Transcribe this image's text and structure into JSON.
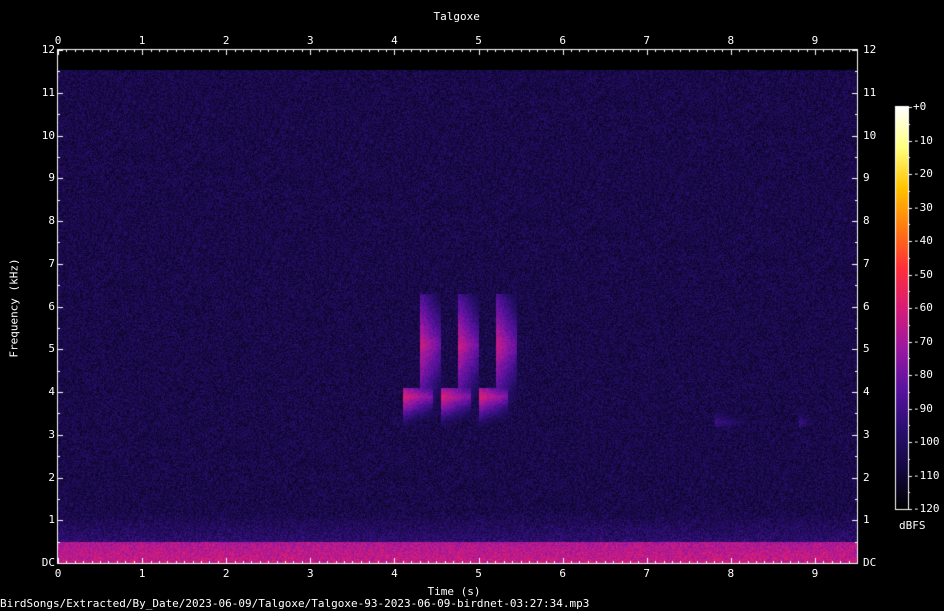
{
  "chart_data": {
    "type": "heatmap",
    "title": "Talgoxe",
    "xlabel": "Time (s)",
    "ylabel": "Frequency (kHz)",
    "xlim": [
      0,
      9.5
    ],
    "ylim": [
      0,
      12
    ],
    "x_ticks": [
      "0",
      "1",
      "2",
      "3",
      "4",
      "5",
      "6",
      "7",
      "8",
      "9"
    ],
    "y_ticks": [
      "DC",
      "1",
      "2",
      "3",
      "4",
      "5",
      "6",
      "7",
      "8",
      "9",
      "10",
      "11",
      "12"
    ],
    "colorbar": {
      "label": "dBFS",
      "range": [
        -120,
        0
      ],
      "ticks": [
        "+0",
        "-10",
        "-20",
        "-30",
        "-40",
        "-50",
        "-60",
        "-70",
        "-80",
        "-90",
        "-100",
        "-110",
        "-120"
      ],
      "colors": [
        "#000000",
        "#14083f",
        "#2a0f70",
        "#5a12a0",
        "#9a18a0",
        "#d81c78",
        "#ff2f3a",
        "#ff7a10",
        "#ffc400",
        "#ffff80",
        "#ffffff"
      ]
    },
    "background_level_dbfs": -105,
    "low_band_level_dbfs": -68,
    "events": [
      {
        "t_start": 4.3,
        "t_end": 4.55,
        "f_low": 3.4,
        "f_high": 6.3,
        "peak_khz": 5.1,
        "level_dbfs": -62
      },
      {
        "t_start": 4.75,
        "t_end": 5.0,
        "f_low": 3.4,
        "f_high": 6.3,
        "peak_khz": 5.1,
        "level_dbfs": -62
      },
      {
        "t_start": 5.2,
        "t_end": 5.45,
        "f_low": 3.4,
        "f_high": 6.3,
        "peak_khz": 5.1,
        "level_dbfs": -62
      },
      {
        "t_start": 4.1,
        "t_end": 4.45,
        "f_low": 3.2,
        "f_high": 4.1,
        "peak_khz": 3.9,
        "level_dbfs": -58
      },
      {
        "t_start": 4.55,
        "t_end": 4.9,
        "f_low": 3.2,
        "f_high": 4.1,
        "peak_khz": 3.9,
        "level_dbfs": -58
      },
      {
        "t_start": 5.0,
        "t_end": 5.35,
        "f_low": 3.2,
        "f_high": 4.1,
        "peak_khz": 3.9,
        "level_dbfs": -58
      },
      {
        "t_start": 7.8,
        "t_end": 8.3,
        "f_low": 3.2,
        "f_high": 4.2,
        "peak_khz": 3.3,
        "level_dbfs": -90
      },
      {
        "t_start": 8.8,
        "t_end": 9.0,
        "f_low": 3.2,
        "f_high": 4.2,
        "peak_khz": 3.3,
        "level_dbfs": -90
      }
    ]
  },
  "footer": {
    "filepath": "BirdSongs/Extracted/By_Date/2023-06-09/Talgoxe/Talgoxe-93-2023-06-09-birdnet-03:27:34.mp3"
  }
}
